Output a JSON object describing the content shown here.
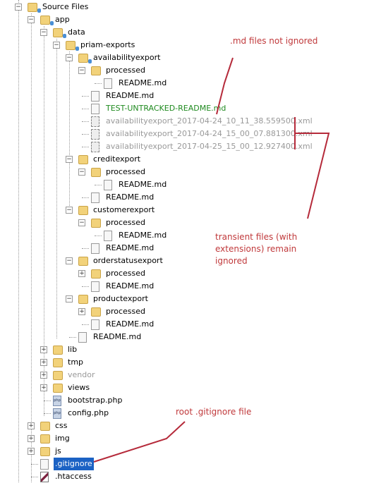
{
  "tree": [
    {
      "label": "Source Files",
      "level": 0,
      "type": "folder",
      "toggle": "-",
      "badge": true
    },
    {
      "label": "app",
      "level": 1,
      "type": "folder",
      "toggle": "-",
      "badge": true
    },
    {
      "label": "data",
      "level": 2,
      "type": "folder",
      "toggle": "-",
      "badge": true
    },
    {
      "label": "priam-exports",
      "level": 3,
      "type": "folder",
      "toggle": "-",
      "badge": true
    },
    {
      "label": "availabilityexport",
      "level": 4,
      "type": "folder",
      "toggle": "-",
      "badge": true
    },
    {
      "label": "processed",
      "level": 5,
      "type": "folder",
      "toggle": "-"
    },
    {
      "label": "README.md",
      "level": 6,
      "type": "file"
    },
    {
      "label": "README.md",
      "level": 5,
      "type": "file"
    },
    {
      "label": "TEST-UNTRACKED-README.md",
      "level": 5,
      "type": "file",
      "status": "untracked"
    },
    {
      "label": "availabilityexport_2017-04-24_10_11_38.559500.xml",
      "level": 5,
      "type": "xml",
      "status": "ignored"
    },
    {
      "label": "availabilityexport_2017-04-24_15_00_07.881300.xml",
      "level": 5,
      "type": "xml",
      "status": "ignored"
    },
    {
      "label": "availabilityexport_2017-04-25_15_00_12.927400.xml",
      "level": 5,
      "type": "xml",
      "status": "ignored"
    },
    {
      "label": "creditexport",
      "level": 4,
      "type": "folder",
      "toggle": "-"
    },
    {
      "label": "processed",
      "level": 5,
      "type": "folder",
      "toggle": "-"
    },
    {
      "label": "README.md",
      "level": 6,
      "type": "file"
    },
    {
      "label": "README.md",
      "level": 5,
      "type": "file"
    },
    {
      "label": "customerexport",
      "level": 4,
      "type": "folder",
      "toggle": "-"
    },
    {
      "label": "processed",
      "level": 5,
      "type": "folder",
      "toggle": "-"
    },
    {
      "label": "README.md",
      "level": 6,
      "type": "file"
    },
    {
      "label": "README.md",
      "level": 5,
      "type": "file"
    },
    {
      "label": "orderstatusexport",
      "level": 4,
      "type": "folder",
      "toggle": "-"
    },
    {
      "label": "processed",
      "level": 5,
      "type": "folder",
      "toggle": "+"
    },
    {
      "label": "README.md",
      "level": 5,
      "type": "file"
    },
    {
      "label": "productexport",
      "level": 4,
      "type": "folder",
      "toggle": "-"
    },
    {
      "label": "processed",
      "level": 5,
      "type": "folder",
      "toggle": "+"
    },
    {
      "label": "README.md",
      "level": 5,
      "type": "file"
    },
    {
      "label": "README.md",
      "level": 4,
      "type": "file"
    },
    {
      "label": "lib",
      "level": 2,
      "type": "folder",
      "toggle": "+"
    },
    {
      "label": "tmp",
      "level": 2,
      "type": "folder",
      "toggle": "+"
    },
    {
      "label": "vendor",
      "level": 2,
      "type": "folder",
      "toggle": "+",
      "status": "ignored"
    },
    {
      "label": "views",
      "level": 2,
      "type": "folder",
      "toggle": "+"
    },
    {
      "label": "bootstrap.php",
      "level": 2,
      "type": "php"
    },
    {
      "label": "config.php",
      "level": 2,
      "type": "php"
    },
    {
      "label": "css",
      "level": 1,
      "type": "folder",
      "toggle": "+"
    },
    {
      "label": "img",
      "level": 1,
      "type": "folder",
      "toggle": "+"
    },
    {
      "label": "js",
      "level": 1,
      "type": "folder",
      "toggle": "+"
    },
    {
      "label": ".gitignore",
      "level": 1,
      "type": "file",
      "selected": true
    },
    {
      "label": ".htaccess",
      "level": 1,
      "type": "htaccess"
    }
  ],
  "annotations": {
    "md_not_ignored": ".md files not ignored",
    "transient_1": "transient files (with",
    "transient_2": "extensions) remain",
    "transient_3": "ignored",
    "root_gitignore": "root .gitignore file"
  },
  "colors": {
    "annotation": "#c0393b",
    "untracked": "#1f8a1f",
    "ignored": "#999999",
    "selection": "#1b62c4"
  }
}
